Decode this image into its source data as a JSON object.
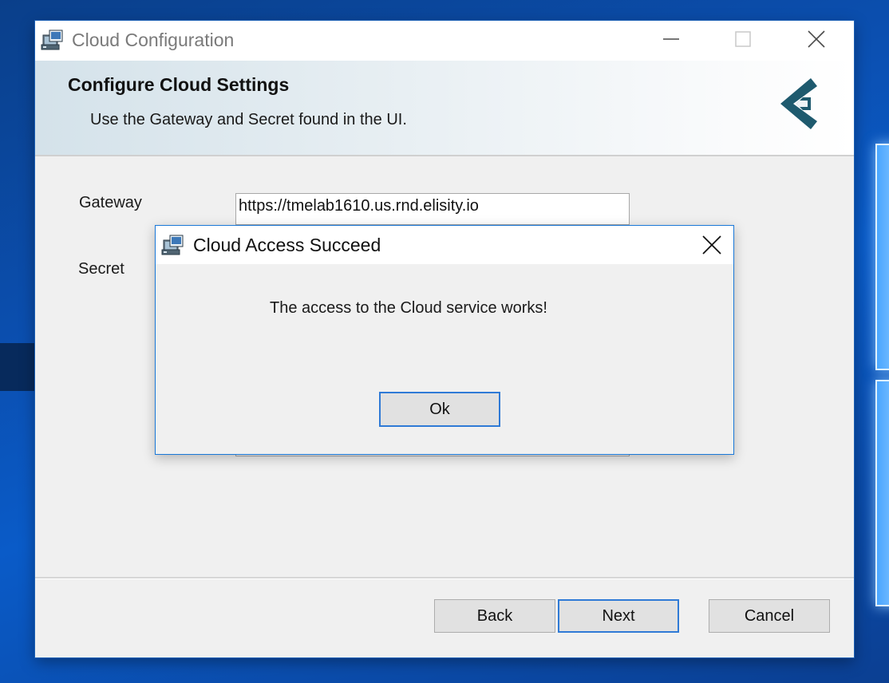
{
  "main_window": {
    "title": "Cloud Configuration",
    "icon": "installer-package-icon",
    "controls": {
      "minimize": "minimize-icon",
      "maximize": "maximize-icon",
      "close": "close-icon"
    }
  },
  "banner": {
    "heading": "Configure Cloud Settings",
    "subheading": "Use the Gateway and Secret found in the UI.",
    "logo": "elisity-logo"
  },
  "form": {
    "gateway": {
      "label": "Gateway",
      "value": "https://tmelab1610.us.rnd.elisity.io"
    },
    "secret": {
      "label": "Secret",
      "value": ""
    }
  },
  "footer": {
    "back_label": "Back",
    "next_label": "Next",
    "cancel_label": "Cancel"
  },
  "dialog": {
    "title": "Cloud Access Succeed",
    "icon": "installer-package-icon",
    "message": "The access to the Cloud service works!",
    "ok_label": "Ok"
  },
  "colors": {
    "accent": "#2f7ad6",
    "dialog_border": "#1a78d8",
    "brand": "#1e5a6e",
    "desktop": "#0b4fb0"
  }
}
